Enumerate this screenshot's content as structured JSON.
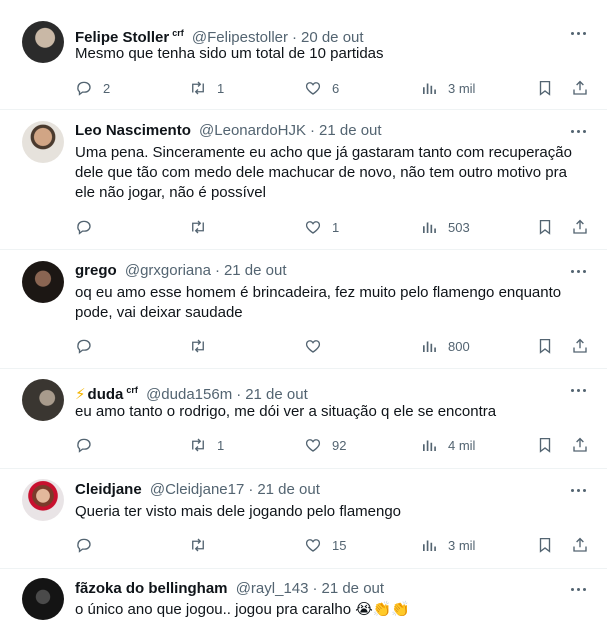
{
  "tweets": [
    {
      "name": "Felipe Stoller",
      "badge": "crf",
      "handle": "@Felipestoller",
      "time": "20 de out",
      "lines": [
        "Mesmo que tenha sido um total de 10 partidas"
      ],
      "replies": "2",
      "retweets": "1",
      "likes": "6",
      "views": "3 mil",
      "avatar_colors": [
        "#2b2b2b",
        "#c9b8a6"
      ]
    },
    {
      "name": "Leo Nascimento",
      "badge": "",
      "handle": "@LeonardoHJK",
      "time": "21 de out",
      "lines": [
        "Uma pena. Sinceramente eu acho que já gastaram tanto com recuperação",
        "dele que tão com medo dele machucar de novo, não tem outro motivo pra",
        "ele não jogar, não é possível"
      ],
      "replies": "",
      "retweets": "",
      "likes": "1",
      "views": "503",
      "avatar_colors": [
        "#e6e2dc",
        "#5b4636"
      ]
    },
    {
      "name": "grego",
      "badge": "",
      "handle": "@grxgoriana",
      "time": "21 de out",
      "lines": [
        "oq eu amo esse homem é brincadeira, fez muito pelo flamengo enquanto",
        "pode, vai deixar saudade"
      ],
      "replies": "",
      "retweets": "",
      "likes": "",
      "views": "800",
      "avatar_colors": [
        "#1c1714",
        "#6b4a3a"
      ]
    },
    {
      "name": "duda",
      "badge": "crf",
      "handle": "@duda156m",
      "time": "21 de out",
      "lines": [
        "eu amo tanto o rodrigo, me dói ver a situação q ele se encontra"
      ],
      "replies": "",
      "retweets": "1",
      "likes": "92",
      "views": "4 mil",
      "avatar_colors": [
        "#3a3631",
        "#a89b8c"
      ]
    },
    {
      "name": "Cleidjane",
      "badge": "",
      "handle": "@Cleidjane17",
      "time": "21 de out",
      "lines": [
        "Queria ter visto mais dele jogando pelo flamengo"
      ],
      "replies": "",
      "retweets": "",
      "likes": "15",
      "views": "3 mil",
      "avatar_colors": [
        "#e9e4e6",
        "#7a3b2a"
      ]
    },
    {
      "name": "fãzoka do bellingham",
      "badge": "",
      "handle": "@rayl_143",
      "time": "21 de out",
      "lines": [
        "o único ano que jogou.. jogou pra caralho 😭👏👏"
      ],
      "replies": "",
      "retweets": "",
      "likes": "",
      "views": "",
      "avatar_colors": [
        "#141414",
        "#4a4a4a"
      ]
    }
  ]
}
